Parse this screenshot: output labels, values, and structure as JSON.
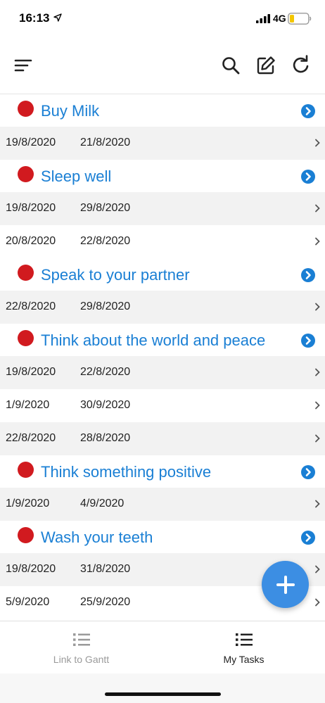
{
  "status_bar": {
    "time": "16:13",
    "network": "4G"
  },
  "toolbar": {
    "icons": [
      "menu-icon",
      "search-icon",
      "edit-icon",
      "refresh-icon"
    ]
  },
  "tasks": [
    {
      "title": "Buy Milk",
      "dates": [
        [
          "19/8/2020",
          "21/8/2020"
        ]
      ]
    },
    {
      "title": "Sleep well",
      "dates": [
        [
          "19/8/2020",
          "29/8/2020"
        ],
        [
          "20/8/2020",
          "22/8/2020"
        ]
      ]
    },
    {
      "title": "Speak to your partner",
      "dates": [
        [
          "22/8/2020",
          "29/8/2020"
        ]
      ]
    },
    {
      "title": "Think about the world and peace",
      "dates": [
        [
          "19/8/2020",
          "22/8/2020"
        ],
        [
          "1/9/2020",
          "30/9/2020"
        ],
        [
          "22/8/2020",
          "28/8/2020"
        ]
      ]
    },
    {
      "title": "Think something positive",
      "dates": [
        [
          "1/9/2020",
          "4/9/2020"
        ]
      ]
    },
    {
      "title": "Wash your teeth",
      "dates": [
        [
          "19/8/2020",
          "31/8/2020"
        ],
        [
          "5/9/2020",
          "25/9/2020"
        ]
      ]
    }
  ],
  "tab_bar": {
    "tabs": [
      {
        "label": "Link to Gantt",
        "active": false
      },
      {
        "label": "My Tasks",
        "active": true
      }
    ]
  },
  "colors": {
    "accent": "#1a7fd4",
    "dot": "#d11a1f",
    "fab": "#3c8ee3",
    "row_shade": "#f2f2f2"
  }
}
